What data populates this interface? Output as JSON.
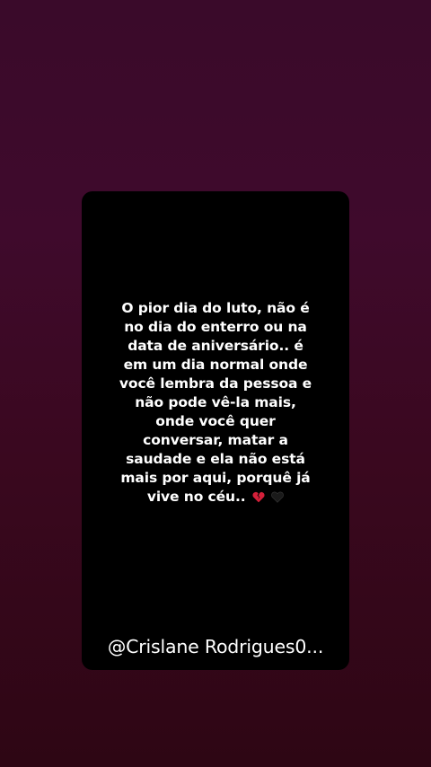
{
  "story": {
    "quote_lines": [
      "O pior dia do luto, não é",
      "no dia do enterro ou na",
      "data de aniversário.. é",
      "em um dia normal onde",
      "você lembra da pessoa e",
      "não pode vê-la mais,",
      "onde você quer",
      "conversar, matar a",
      "saudade e ela não está",
      "mais por aqui, porquê já",
      "vive no céu.."
    ],
    "emojis": [
      "broken-heart-icon",
      "black-heart-icon"
    ],
    "username": "@Crislane Rodrigues0..."
  },
  "colors": {
    "background_top": "#3a0a2a",
    "background_bottom": "#2e0614",
    "card": "#000000",
    "text": "#ffffff",
    "broken_heart": "#d4203a",
    "black_heart": "#1a1a1a"
  }
}
